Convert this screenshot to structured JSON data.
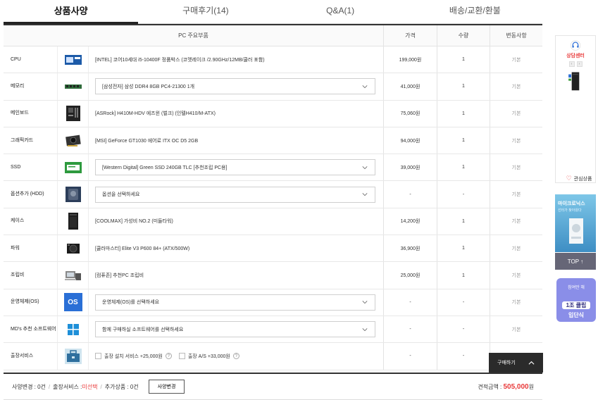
{
  "tabs": [
    {
      "label": "상품사양",
      "active": true
    },
    {
      "label": "구매후기(14)",
      "active": false
    },
    {
      "label": "Q&A(1)",
      "active": false
    },
    {
      "label": "배송/교환/환불",
      "active": false
    }
  ],
  "table": {
    "headers": {
      "main": "PC 주요부품",
      "price": "가격",
      "qty": "수량",
      "change": "변동사항"
    },
    "rows": [
      {
        "name": "CPU",
        "icon": "cpu-box-icon",
        "desc": "[INTEL] 코어10세대 i5-10400F 정품박스 (코멧레이크 /2.90GHz/12MB/쿨러 포함)",
        "select": false,
        "price": "199,000원",
        "qty": "1",
        "change": "기본"
      },
      {
        "name": "메모리",
        "icon": "ram-stick-icon",
        "desc": "[삼성전자] 삼성 DDR4 8GB PC4-21300 1개",
        "select": true,
        "price": "41,000원",
        "qty": "1",
        "change": "기본"
      },
      {
        "name": "메인보드",
        "icon": "motherboard-icon",
        "desc": "[ASRock] H410M-HDV 에즈윈 (벌크) (인텔H410/M-ATX)",
        "select": false,
        "price": "75,060원",
        "qty": "1",
        "change": "기본"
      },
      {
        "name": "그래픽카드",
        "icon": "graphics-card-icon",
        "desc": "[MSI] GeForce GT1030 에어로 ITX OC D5 2GB",
        "select": false,
        "price": "94,000원",
        "qty": "1",
        "change": "기본"
      },
      {
        "name": "SSD",
        "icon": "ssd-icon",
        "desc": "[Western Digital] Green SSD 240GB TLC [추천조립 PC용]",
        "select": true,
        "price": "39,000원",
        "qty": "1",
        "change": "기본"
      },
      {
        "name": "옵션추가 (HDD)",
        "icon": "hdd-icon",
        "desc": "옵션을 선택하세요",
        "select": true,
        "price": "-",
        "qty": "-",
        "change": "기본"
      },
      {
        "name": "케이스",
        "icon": "pc-case-icon",
        "desc": "[COOLMAX] 가성비 NO.2 (미들타워)",
        "select": false,
        "price": "14,200원",
        "qty": "1",
        "change": "기본"
      },
      {
        "name": "파워",
        "icon": "power-supply-icon",
        "desc": "[쿨러마스터] Elite V3 P600 84+ (ATX/500W)",
        "select": false,
        "price": "36,900원",
        "qty": "1",
        "change": "기본"
      },
      {
        "name": "조립비",
        "icon": "assembly-service-icon",
        "desc": "[컴퓨존] 추천PC 조립비",
        "select": false,
        "price": "25,000원",
        "qty": "1",
        "change": "기본"
      },
      {
        "name": "운영체제(OS)",
        "icon": "os-badge-icon",
        "desc": "운영체제(OS)를 선택하세요",
        "select": true,
        "price": "-",
        "qty": "-",
        "change": "기본"
      },
      {
        "name": "MD's 추천 소프트웨어",
        "icon": "windows-logo-icon",
        "desc": "함께 구매하실 소프트웨어를 선택하세요",
        "select": true,
        "price": "-",
        "qty": "-",
        "change": "기본"
      },
      {
        "name": "출장서비스",
        "icon": "toolbox-icon",
        "desc": "",
        "select": false,
        "price": "-",
        "qty": "-",
        "change": ""
      }
    ],
    "os_badge_text": "OS",
    "services": [
      {
        "label": "출장 설치 서비스 +25,000원"
      },
      {
        "label": "출장 A/S +33,000원"
      }
    ]
  },
  "summary": {
    "spec_change_label": "사양변경 : 0건",
    "service_label": "출장서비스 : ",
    "service_value": "미선택",
    "added_label": "추가상품 : 0건",
    "change_button": "사양변경",
    "total_label": "견적금액 : ",
    "total_amount": "505,000",
    "total_unit": "원"
  },
  "buy_bar": {
    "label": "구매하기"
  },
  "sidebar": {
    "cs_label": "상담센터",
    "wish_label": "관심상품",
    "ad1_title": "마이크로닉스",
    "ad1_sub": "선터가 찾아왔다",
    "top_label": "TOP ↑",
    "ad2_top": "참여만 해",
    "ad2_mid": "1조 클립",
    "ad2_bot": "입단식"
  },
  "colors": {
    "accent_red": "#e83a3a",
    "dark": "#2b2b2b",
    "os_blue": "#2a6fd6"
  }
}
